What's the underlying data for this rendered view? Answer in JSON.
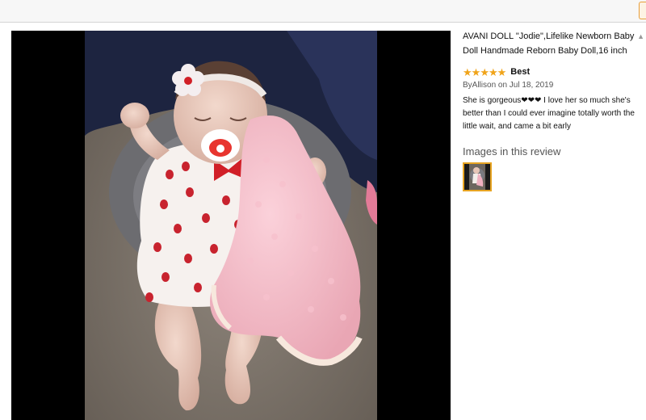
{
  "review": {
    "product_title": "AVANI DOLL \"Jodie\",Lifelike Newborn Baby Doll Handmade Reborn Baby Doll,16 inch",
    "rating": 5,
    "max_rating": 5,
    "headline": "Best",
    "byline": "ByAllison on Jul 18, 2019",
    "body": "She is gorgeous❤❤❤ I love her so much she's better than I could ever imagine totally worth the little wait, and came a bit early",
    "images_heading": "Images in this review"
  },
  "colors": {
    "star": "#f0a41a",
    "thumb_border": "#e7a422",
    "viewer_bg": "#000000"
  },
  "icons": {
    "star": "star-icon",
    "scroll_caret": "caret-up-icon"
  },
  "scroll_caret": "▲"
}
